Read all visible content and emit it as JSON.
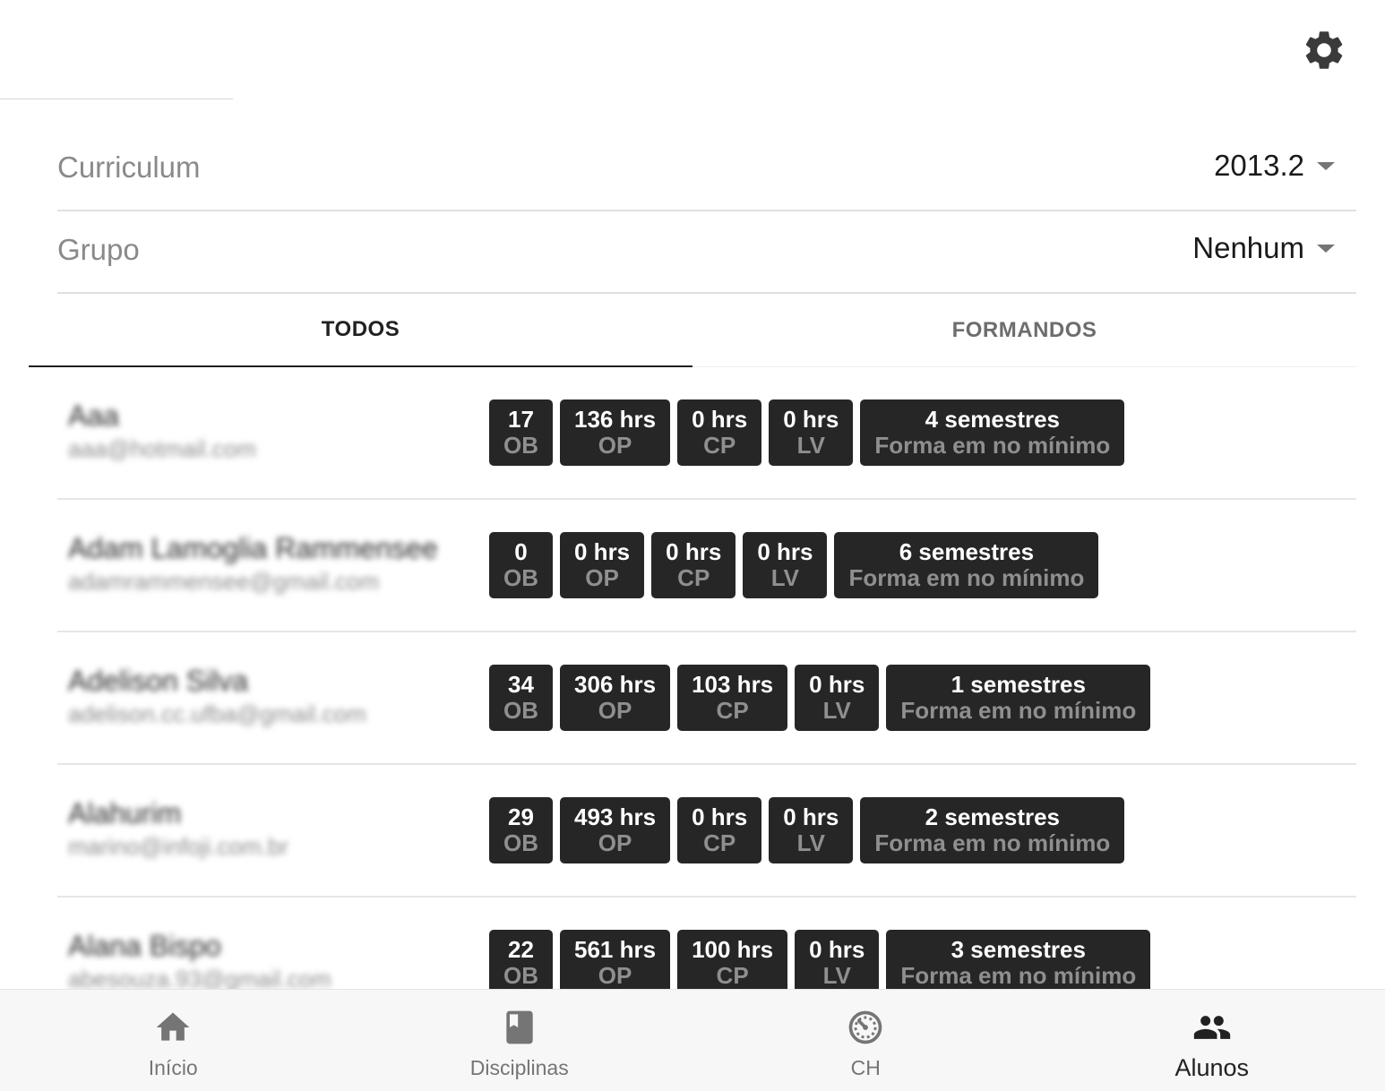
{
  "header": {
    "settings_icon": "gear-icon"
  },
  "filters": {
    "curriculum": {
      "label": "Curriculum",
      "value": "2013.2"
    },
    "grupo": {
      "label": "Grupo",
      "value": "Nenhum"
    }
  },
  "tabs": [
    {
      "label": "TODOS",
      "active": true
    },
    {
      "label": "FORMANDOS",
      "active": false
    }
  ],
  "students": [
    {
      "name": "Aaa",
      "email": "aaa@hotmail.com",
      "badges": [
        {
          "value": "17",
          "label": "OB"
        },
        {
          "value": "136 hrs",
          "label": "OP"
        },
        {
          "value": "0 hrs",
          "label": "CP"
        },
        {
          "value": "0 hrs",
          "label": "LV"
        },
        {
          "value": "4 semestres",
          "label": "Forma em no mínimo"
        }
      ]
    },
    {
      "name": "Adam Lamoglia Rammensee",
      "email": "adamrammensee@gmail.com",
      "badges": [
        {
          "value": "0",
          "label": "OB"
        },
        {
          "value": "0 hrs",
          "label": "OP"
        },
        {
          "value": "0 hrs",
          "label": "CP"
        },
        {
          "value": "0 hrs",
          "label": "LV"
        },
        {
          "value": "6 semestres",
          "label": "Forma em no mínimo"
        }
      ]
    },
    {
      "name": "Adelison Silva",
      "email": "adelison.cc.ufba@gmail.com",
      "badges": [
        {
          "value": "34",
          "label": "OB"
        },
        {
          "value": "306 hrs",
          "label": "OP"
        },
        {
          "value": "103 hrs",
          "label": "CP"
        },
        {
          "value": "0 hrs",
          "label": "LV"
        },
        {
          "value": "1 semestres",
          "label": "Forma em no mínimo"
        }
      ]
    },
    {
      "name": "Alahurim",
      "email": "marino@infoji.com.br",
      "badges": [
        {
          "value": "29",
          "label": "OB"
        },
        {
          "value": "493 hrs",
          "label": "OP"
        },
        {
          "value": "0 hrs",
          "label": "CP"
        },
        {
          "value": "0 hrs",
          "label": "LV"
        },
        {
          "value": "2 semestres",
          "label": "Forma em no mínimo"
        }
      ]
    },
    {
      "name": "Alana Bispo",
      "email": "abesouza.93@gmail.com",
      "badges": [
        {
          "value": "22",
          "label": "OB"
        },
        {
          "value": "561 hrs",
          "label": "OP"
        },
        {
          "value": "100 hrs",
          "label": "CP"
        },
        {
          "value": "0 hrs",
          "label": "LV"
        },
        {
          "value": "3 semestres",
          "label": "Forma em no mínimo"
        }
      ]
    }
  ],
  "bottom_nav": [
    {
      "label": "Início",
      "icon": "home-icon",
      "active": false
    },
    {
      "label": "Disciplinas",
      "icon": "book-icon",
      "active": false
    },
    {
      "label": "CH",
      "icon": "timer-icon",
      "active": false
    },
    {
      "label": "Alunos",
      "icon": "people-icon",
      "active": true
    }
  ]
}
